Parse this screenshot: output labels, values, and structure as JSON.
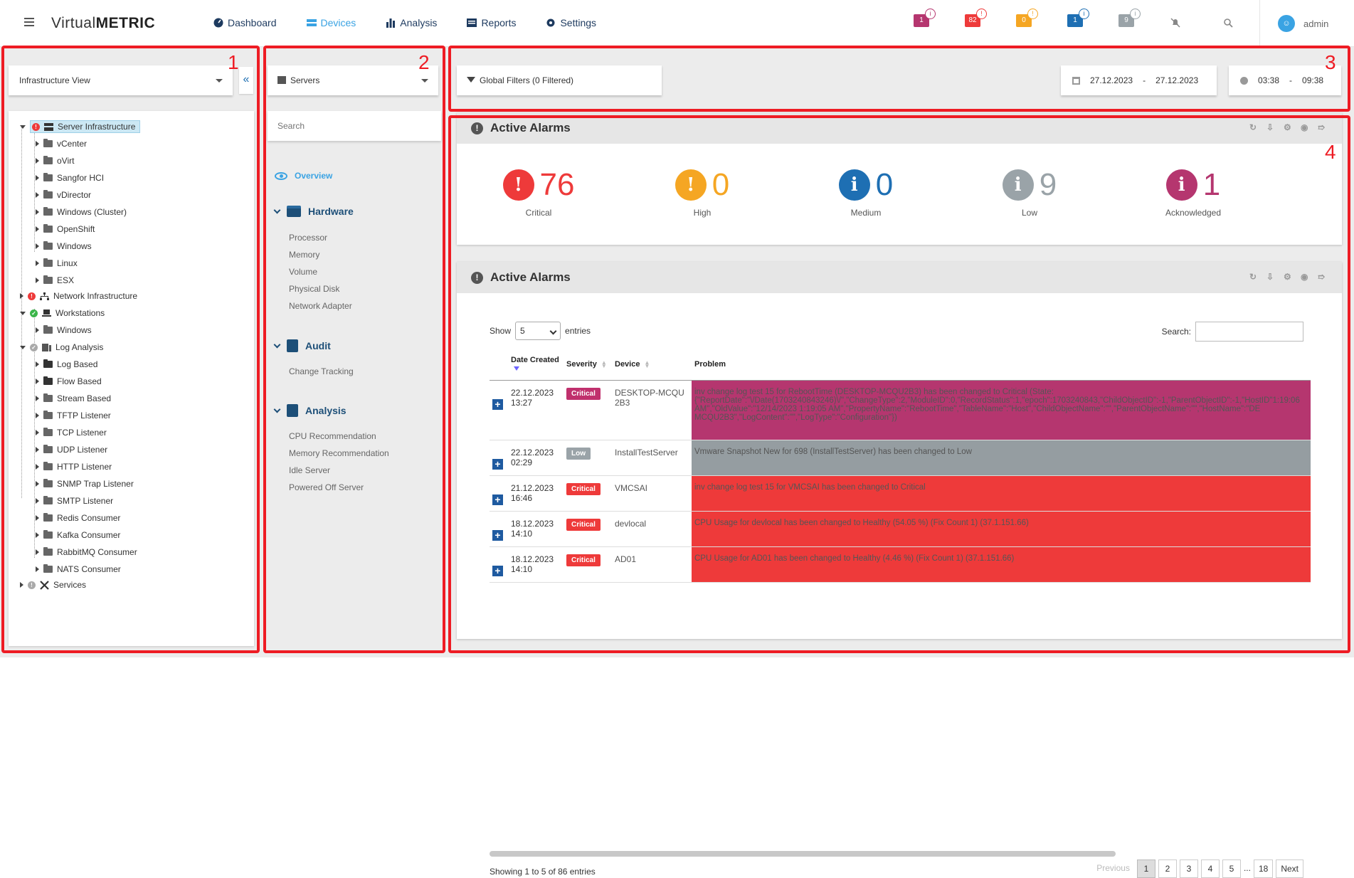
{
  "app": {
    "logo_prefix": "Virtual",
    "logo_bold": "METRIC"
  },
  "nav": [
    {
      "label": "Dashboard",
      "icon": "dashboard-icon",
      "active": false
    },
    {
      "label": "Devices",
      "icon": "devices-icon",
      "active": true
    },
    {
      "label": "Analysis",
      "icon": "bar-chart-icon",
      "active": false
    },
    {
      "label": "Reports",
      "icon": "reports-icon",
      "active": false
    },
    {
      "label": "Settings",
      "icon": "gear-icon",
      "active": false
    }
  ],
  "badges": [
    {
      "value": "1",
      "color": "#b5366f"
    },
    {
      "value": "82",
      "color": "#ee3a3a"
    },
    {
      "value": "0",
      "color": "#f5a623"
    },
    {
      "value": "1",
      "color": "#1e6fb3"
    },
    {
      "value": "9",
      "color": "#9aa3a8"
    }
  ],
  "user": {
    "name": "admin"
  },
  "annotations": {
    "box1": "1",
    "box2": "2",
    "box3": "3",
    "box4": "4"
  },
  "panel1": {
    "view_select": "Infrastructure View",
    "collapse_label": "«",
    "tree": {
      "server_infrastructure": "Server Infrastructure",
      "server_children": [
        "vCenter",
        "oVirt",
        "Sangfor HCI",
        "vDirector",
        "Windows (Cluster)",
        "OpenShift",
        "Windows",
        "Linux",
        "ESX"
      ],
      "network_infrastructure": "Network Infrastructure",
      "workstations": "Workstations",
      "workstation_children": [
        "Windows"
      ],
      "log_analysis": "Log Analysis",
      "log_children": [
        "Log Based",
        "Flow Based",
        "Stream Based",
        "TFTP Listener",
        "TCP Listener",
        "UDP Listener",
        "HTTP Listener",
        "SNMP Trap Listener",
        "SMTP Listener",
        "Redis Consumer",
        "Kafka Consumer",
        "RabbitMQ Consumer",
        "NATS Consumer"
      ],
      "services": "Services"
    }
  },
  "panel2": {
    "category_select": "Servers",
    "search_placeholder": "Search",
    "overview": "Overview",
    "hardware": {
      "title": "Hardware",
      "items": [
        "Processor",
        "Memory",
        "Volume",
        "Physical Disk",
        "Network Adapter"
      ]
    },
    "audit": {
      "title": "Audit",
      "items": [
        "Change Tracking"
      ]
    },
    "analysis": {
      "title": "Analysis",
      "items": [
        "CPU Recommendation",
        "Memory Recommendation",
        "Idle Server",
        "Powered Off Server"
      ]
    }
  },
  "panel3": {
    "global_filters": "Global Filters (0 Filtered)",
    "date_from": "27.12.2023",
    "date_to": "27.12.2023",
    "time_from": "03:38",
    "time_to": "09:38",
    "range_sep": "-"
  },
  "summary_widget": {
    "title": "Active Alarms",
    "items": [
      {
        "label": "Critical",
        "value": "76",
        "color": "#ee3a3a",
        "symbol": "!"
      },
      {
        "label": "High",
        "value": "0",
        "color": "#f5a623",
        "symbol": "!"
      },
      {
        "label": "Medium",
        "value": "0",
        "color": "#1e6fb3",
        "symbol": "i"
      },
      {
        "label": "Low",
        "value": "9",
        "color": "#9aa3a8",
        "symbol": "i"
      },
      {
        "label": "Acknowledged",
        "value": "1",
        "color": "#b5366f",
        "symbol": "i"
      }
    ]
  },
  "table_widget": {
    "title": "Active Alarms",
    "show_label": "Show",
    "entries_value": "5",
    "entries_label": "entries",
    "search_label": "Search:",
    "columns": [
      "Date Created",
      "Severity",
      "Device",
      "Problem"
    ],
    "rows": [
      {
        "date": "22.12.2023 13:27",
        "severity": "Critical",
        "sev_style": "crit-dark",
        "device": "DESKTOP-MCQU2B3",
        "problem": "inv change log test 15 for RebootTime (DESKTOP-MCQU2B3) has been changed to Critical (State: {\"ReportDate\":\"\\/Date(1703240843246)\\/\",\"ChangeType\":2,\"ModuleID\":0,\"RecordStatus\":1,\"epoch\":1703240843,\"ChildObjectID\":-1,\"ParentObjectID\":-1,\"HostID\"1:19:06 AM\",\"OldValue\":\"12/14/2023 1:19:05 AM\",\"PropertyName\":\"RebootTime\",\"TableName\":\"Host\",\"ChildObjectName\":\"\",\"ParentObjectName\":\"\",\"HostName\":\"DE MCQU2B3\",\"LogContent\":\"\",\"LogType\":\"Configuration\"})",
        "row_color": "magenta"
      },
      {
        "date": "22.12.2023 02:29",
        "severity": "Low",
        "sev_style": "low",
        "device": "InstallTestServer",
        "problem": "Vmware Snapshot New for 698 (InstallTestServer) has been changed to Low",
        "row_color": "gray"
      },
      {
        "date": "21.12.2023 16:46",
        "severity": "Critical",
        "sev_style": "crit",
        "device": "VMCSAI",
        "problem": "inv change log test 15 for VMCSAI has been changed to Critical",
        "row_color": "red"
      },
      {
        "date": "18.12.2023 14:10",
        "severity": "Critical",
        "sev_style": "crit",
        "device": "devlocal",
        "problem": "CPU Usage for devlocal has been changed to Healthy (54.05 %) (Fix Count 1) (37.1.151.66)",
        "row_color": "red"
      },
      {
        "date": "18.12.2023 14:10",
        "severity": "Critical",
        "sev_style": "crit",
        "device": "AD01",
        "problem": "CPU Usage for AD01 has been changed to Healthy (4.46 %) (Fix Count 1) (37.1.151.66)",
        "row_color": "red"
      }
    ],
    "info": "Showing 1 to 5 of 86 entries",
    "pager": {
      "previous": "Previous",
      "pages": [
        "1",
        "2",
        "3",
        "4",
        "5"
      ],
      "ellipsis": "...",
      "last": "18",
      "next": "Next"
    }
  }
}
